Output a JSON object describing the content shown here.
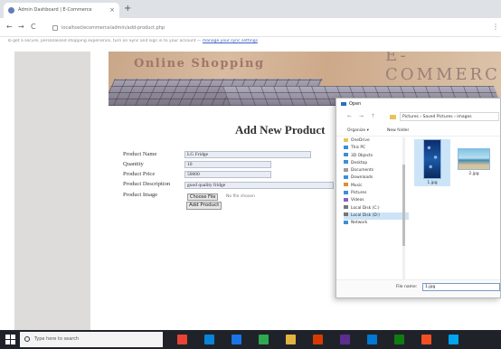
{
  "browser": {
    "tab_title": "Admin Dashboard | E-Commerce",
    "tab_close": "×",
    "new_tab": "+",
    "back": "←",
    "forward": "→",
    "reload": "C",
    "url": "localhost/ecommerce/admin/add-product.php",
    "menu": "⋮",
    "notice_text": "To get a secure, personalised shopping experience, turn on Sync and sign in to your account —",
    "notice_link": "manage your sync settings"
  },
  "banner": {
    "title": "Online Shopping",
    "brand": "E-COMMERCE"
  },
  "form": {
    "heading": "Add New Product",
    "name_label": "Product Name",
    "name_value": "LG Fridge",
    "qty_label": "Quantity",
    "qty_value": "10",
    "price_label": "Product Price",
    "price_value": "50000",
    "desc_label": "Product Description",
    "desc_value": "good quality fridge",
    "image_label": "Product Image",
    "choose_file": "Choose File",
    "file_status": "No file chosen",
    "submit_label": "Add Product"
  },
  "dialog": {
    "title": "Open",
    "nav_arrows": "← → ↑",
    "path": "Pictures › Saved Pictures › images",
    "organize": "Organize ▾",
    "new_folder": "New folder",
    "tree": [
      "OneDrive",
      "This PC",
      "3D Objects",
      "Desktop",
      "Documents",
      "Downloads",
      "Music",
      "Pictures",
      "Videos",
      "Local Disk (C:)",
      "Local Disk (D:)",
      "Network"
    ],
    "selected_tree_index": 10,
    "files": [
      {
        "name": "1.jpg",
        "kind": "phone"
      },
      {
        "name": "2.jpg",
        "kind": "beach"
      }
    ],
    "selected_file_index": 0,
    "file_name_label": "File name:",
    "file_name_value": "1.jpg"
  },
  "taskbar": {
    "search_placeholder": "Type here to search",
    "icon_colors": [
      "#e94335",
      "#0a84d8",
      "#1a73e8",
      "#2fa84f",
      "#e3b341",
      "#d83b01",
      "#5c2d91",
      "#0078d4",
      "#107c10",
      "#f25022",
      "#00a4ef"
    ]
  },
  "colors": {
    "left_panel": "#dedbdb",
    "banner_text": "#a0766a",
    "field_bg": "#e8ecf5",
    "taskbar": "#1f2329"
  }
}
